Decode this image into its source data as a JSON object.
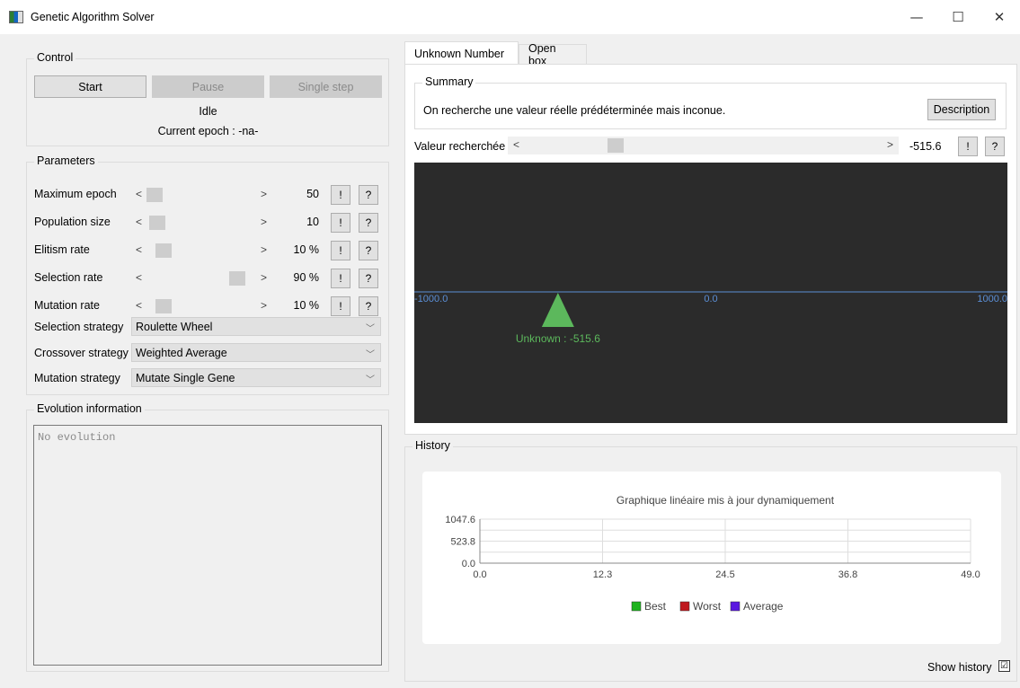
{
  "window": {
    "title": "Genetic Algorithm Solver",
    "minimize": "—",
    "maximize": "☐",
    "close": "✕"
  },
  "control": {
    "label": "Control",
    "start": "Start",
    "pause": "Pause",
    "single_step": "Single step",
    "status": "Idle",
    "epoch": "Current epoch : -na-"
  },
  "parameters": {
    "label": "Parameters",
    "rows": [
      {
        "label": "Maximum epoch",
        "value": "50",
        "level": 0.0
      },
      {
        "label": "Population size",
        "value": "10",
        "level": 0.03
      },
      {
        "label": "Elitism rate",
        "value": "10 %",
        "level": 0.1
      },
      {
        "label": "Selection rate",
        "value": "90 %",
        "level": 0.9
      },
      {
        "label": "Mutation rate",
        "value": "10 %",
        "level": 0.1
      }
    ],
    "bang": "!",
    "help": "?",
    "selection_strategy": {
      "label": "Selection strategy",
      "value": "Roulette Wheel"
    },
    "crossover_strategy": {
      "label": "Crossover strategy",
      "value": "Weighted Average"
    },
    "mutation_strategy": {
      "label": "Mutation strategy",
      "value": "Mutate Single Gene"
    }
  },
  "evolution": {
    "label": "Evolution information",
    "text": "No evolution"
  },
  "tabs": [
    {
      "label": "Unknown Number",
      "active": true
    },
    {
      "label": "Open box",
      "active": false
    }
  ],
  "summary": {
    "label": "Summary",
    "text": "On recherche une valeur réelle prédéterminée mais inconue.",
    "description_button": "Description"
  },
  "target": {
    "label": "Valeur recherchée",
    "value": "-515.6",
    "level": 0.242,
    "bang": "!",
    "help": "?"
  },
  "axis_view": {
    "min_label": "-1000.0",
    "mid_label": "0.0",
    "max_label": "1000.0",
    "min": -1000,
    "max": 1000,
    "marker_value": -515.6,
    "marker_label": "Unknown : -515.6",
    "line_color": "#5b8fd6",
    "marker_color": "#5cb85c"
  },
  "history": {
    "label": "History",
    "show_history_label": "Show history",
    "show_history_checked": "☑"
  },
  "chart_data": {
    "type": "line",
    "title": "Graphique linéaire mis à jour dynamiquement",
    "xlim": [
      0,
      49
    ],
    "ylim": [
      0,
      1047.6
    ],
    "x_ticks": [
      "0.0",
      "12.3",
      "24.5",
      "36.8",
      "49.0"
    ],
    "y_ticks": [
      "1047.6",
      "523.8",
      "0.0"
    ],
    "grid": true,
    "legend_position": "bottom",
    "series": [
      {
        "name": "Best",
        "color": "#1db31d",
        "values": []
      },
      {
        "name": "Worst",
        "color": "#c0181e",
        "values": []
      },
      {
        "name": "Average",
        "color": "#5a18e0",
        "values": []
      }
    ]
  }
}
